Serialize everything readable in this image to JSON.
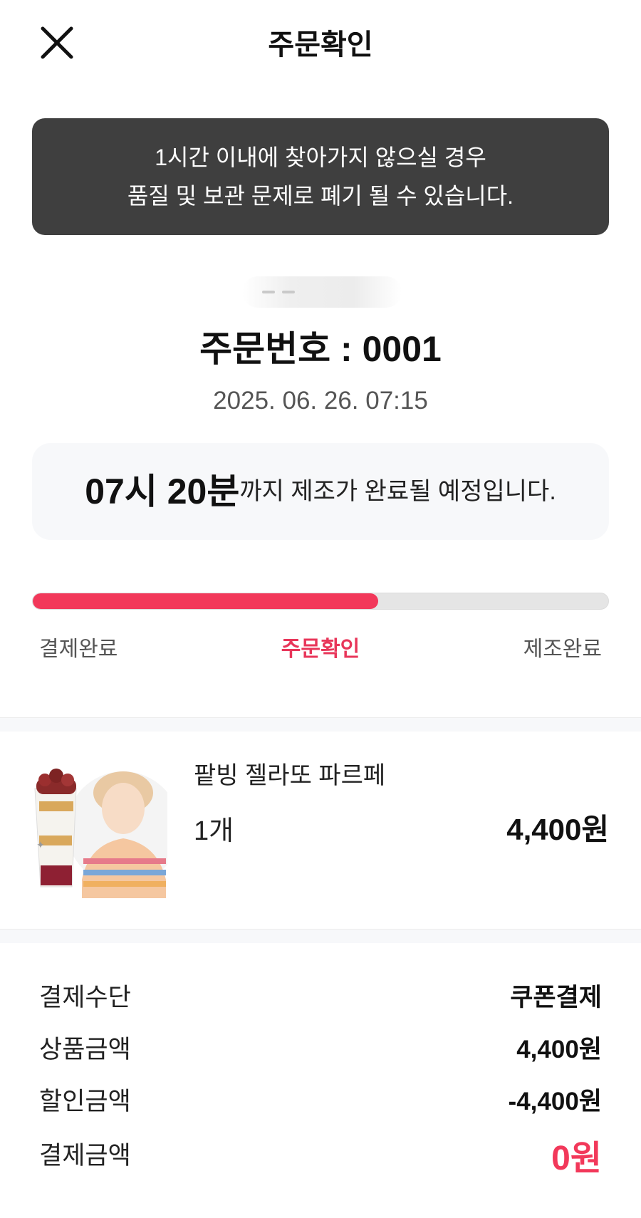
{
  "header": {
    "title": "주문확인",
    "close_icon": "close-icon"
  },
  "notice": {
    "line1": "1시간 이내에 찾아가지 않으실 경우",
    "line2": "품질 및 보관 문제로 폐기 될 수 있습니다."
  },
  "order": {
    "number_label": "주문번호 : 0001",
    "datetime": "2025. 06. 26. 07:15"
  },
  "eta": {
    "time": "07시 20분",
    "message": "까지 제조가 완료될 예정입니다."
  },
  "progress": {
    "fraction": 0.6,
    "steps": [
      "결제완료",
      "주문확인",
      "제조완료"
    ],
    "active_step": 1,
    "fill_color": "#f2385a"
  },
  "product": {
    "name": "팥빙 젤라또 파르페",
    "quantity": "1개",
    "price": "4,400원"
  },
  "summary": {
    "rows": [
      {
        "label": "결제수단",
        "value": "쿠폰결제"
      },
      {
        "label": "상품금액",
        "value": "4,400원"
      },
      {
        "label": "할인금액",
        "value": "-4,400원"
      },
      {
        "label": "결제금액",
        "value": "0원"
      }
    ],
    "total_color": "#f2385a"
  }
}
